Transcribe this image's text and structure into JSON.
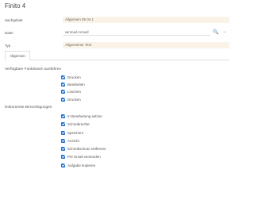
{
  "dialog": {
    "title": "Finito 4"
  },
  "fields": [
    {
      "label": "Sachgebiet",
      "value": "Allgemein 05 04.1"
    },
    {
      "label": "Datei",
      "value": "winmail.mmwd",
      "type": "input"
    },
    {
      "label": "Typ",
      "value": "Allgemeiner Text"
    }
  ],
  "tabs": [
    {
      "label": "Allgemein"
    }
  ],
  "sections": {
    "permissions_label": "Verfügbare Funktionen ausführen",
    "permissions": [
      "Drucken",
      "Bearbeiten",
      "Löschen",
      "Drucken"
    ],
    "doc_label": "Dokumente Berechtigungen",
    "doc_permissions": [
      "In Bearbeitung setzen",
      "Schreibrechte",
      "Speichern",
      "Ansicht",
      "Schreibschutz entfernen",
      "Per Email versenden",
      "Aufgabe kopieren"
    ]
  },
  "colors": {
    "accent": "#1b6fd1",
    "readonly_field": "#fbf3e7"
  },
  "icons": [
    "search-icon",
    "delete-icon"
  ]
}
